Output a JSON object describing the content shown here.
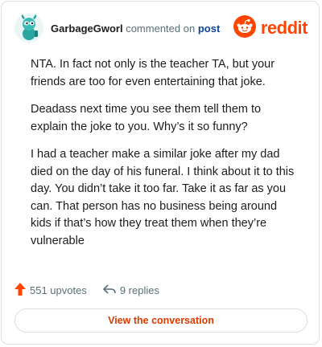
{
  "header": {
    "username": "GarbageGworl",
    "action_text": "commented on",
    "target_link": "post",
    "brand_name": "reddit",
    "avatar_icon": "snoo-avatar-icon",
    "brand_icon": "reddit-logo-icon"
  },
  "comment": {
    "paragraphs": [
      "NTA. In fact not only is the teacher TA, but your friends are too for even entertaining that joke.",
      "Deadass next time you see them tell them to explain the joke to you. Why’s it so funny?",
      "I had a teacher make a similar joke after my dad died on the day of his funeral. I think about it to this day. You didn’t take it too far. Take it as far as you can. That person has no business being around kids if that’s how they treat them when they’re vulnerable"
    ]
  },
  "stats": {
    "upvotes": "551 upvotes",
    "replies": "9 replies"
  },
  "cta": {
    "label": "View the conversation"
  },
  "colors": {
    "brand": "#ff4500",
    "link": "#0a449b",
    "muted": "#576f76",
    "cta": "#d93a00",
    "avatar": "#2aa5a0"
  }
}
